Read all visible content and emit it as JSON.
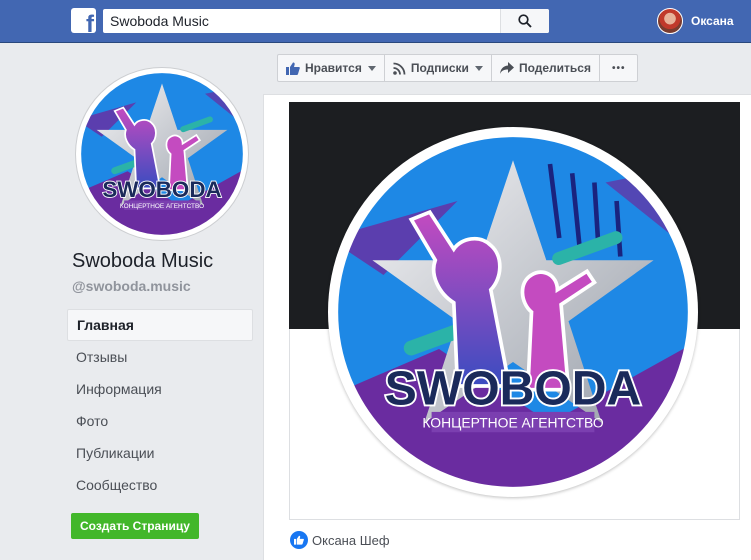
{
  "header": {
    "logo": "facebook-logo",
    "search_value": "Swoboda Music",
    "user_name": "Оксана"
  },
  "page": {
    "name": "Swoboda Music",
    "handle": "@swoboda.music",
    "logo_title": "SWOBODA",
    "logo_subtitle": "КОНЦЕРТНОЕ АГЕНТСТВО"
  },
  "nav": [
    {
      "label": "Главная",
      "active": true
    },
    {
      "label": "Отзывы"
    },
    {
      "label": "Информация"
    },
    {
      "label": "Фото"
    },
    {
      "label": "Публикации"
    },
    {
      "label": "Сообщество"
    }
  ],
  "create_page_label": "Создать Страницу",
  "actions": {
    "like": "Нравится",
    "follow": "Подписки",
    "share": "Поделиться",
    "more": "•••"
  },
  "liked_by": "Оксана Шеф",
  "colors": {
    "topbar": "#4267b2",
    "logo_blue": "#1e88e5",
    "logo_purple": "#6a2ca0",
    "logo_magenta": "#d63aa3",
    "logo_teal": "#2bb3a8",
    "green_button": "#42b72a"
  }
}
